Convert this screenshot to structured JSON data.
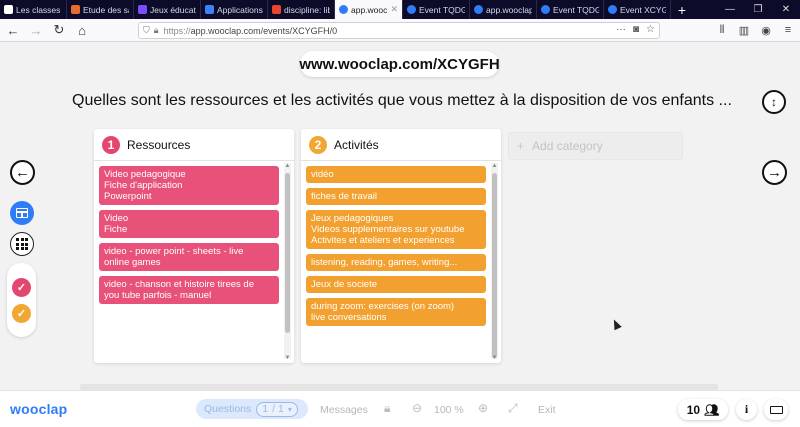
{
  "browser": {
    "tabs": [
      {
        "title": "Les classes inverse",
        "color": "#ffffff"
      },
      {
        "title": "Etude des sa",
        "color": "#e86a2c"
      },
      {
        "title": "Jeux éducatif",
        "color": "#7c4dff"
      },
      {
        "title": "Applications",
        "color": "#3b82f6"
      },
      {
        "title": "discipline: lib",
        "color": "#e8452c"
      },
      {
        "title": "app.wooclap",
        "color": "#2f7df6",
        "active": true
      },
      {
        "title": "Event TQDG",
        "color": "#2f7df6"
      },
      {
        "title": "app.wooclap",
        "color": "#2f7df6"
      },
      {
        "title": "Event TQDG",
        "color": "#2f7df6"
      },
      {
        "title": "Event XCYGF",
        "color": "#2f7df6"
      }
    ],
    "new_tab": "+",
    "url_prefix": "https://",
    "url_rest": "app.wooclap.com/events/XCYGFH/0"
  },
  "event": {
    "code_url": "www.wooclap.com/XCYGFH",
    "question": "Quelles sont les ressources et les activités que vous mettez à la disposition de vos enfants ..."
  },
  "columns": [
    {
      "number": "1",
      "title": "Ressources",
      "color": "#e5466f",
      "cards": [
        "Video pedagogique\nFiche d'application\nPowerpoint",
        "Video\nFiche",
        "video - power point - sheets - live\nonline games",
        "video - chanson et histoire tirees de\nyou tube parfois - manuel"
      ]
    },
    {
      "number": "2",
      "title": "Activités",
      "color": "#f2a733",
      "cards": [
        "vidéo",
        "fiches de travail",
        "Jeux pedagogiques\nVideos supplementaires sur youtube\nActivites et ateliers et experiences",
        "listening, reading, games, writing...",
        "Jeux de societe",
        "during zoom: exercises (on zoom)\nlive conversations"
      ]
    }
  ],
  "add_category": "Add category",
  "footer": {
    "logo": "wooclap",
    "questions_label": "Questions",
    "page_current": "1",
    "page_total": "/ 1",
    "messages_label": "Messages",
    "zoom": "100 %",
    "exit_label": "Exit",
    "participants": "10"
  },
  "colors": {
    "accent_blue": "#2f7df6",
    "pink": "#e5466f",
    "orange": "#f2a733"
  }
}
